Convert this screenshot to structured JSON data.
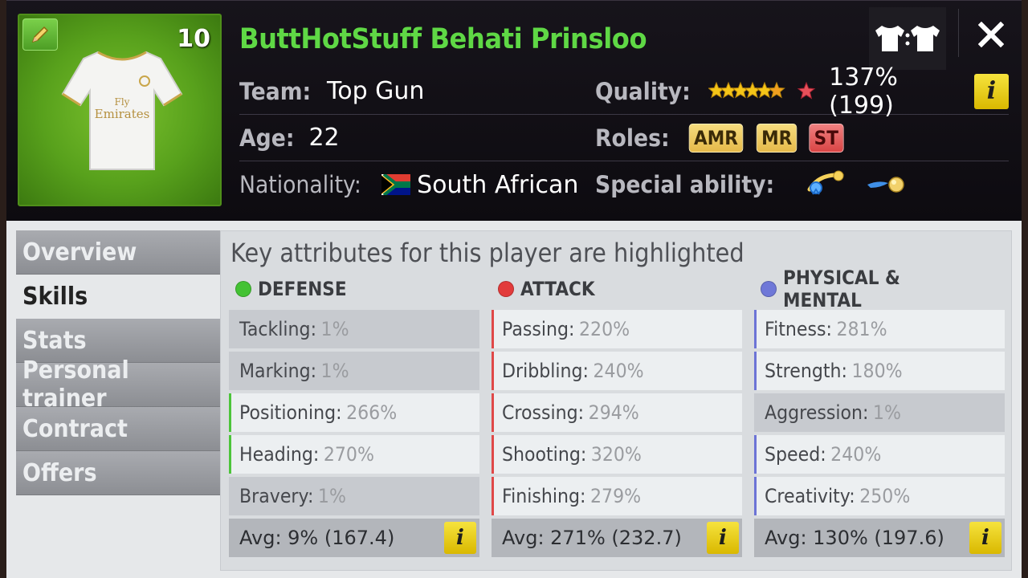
{
  "player": {
    "name": "ButtHotStuff Behati Prinsloo",
    "number": "10",
    "jersey_text": "Fly Emirates"
  },
  "info": {
    "team_label": "Team:",
    "team_value": "Top Gun",
    "age_label": "Age:",
    "age_value": "22",
    "nationality_label": "Nationality:",
    "nationality_value": "South African",
    "quality_label": "Quality:",
    "quality_value": "137% (199)",
    "quality_stars": 6,
    "roles_label": "Roles:",
    "roles": [
      "AMR",
      "MR",
      "ST"
    ],
    "special_label": "Special ability:"
  },
  "tabs": [
    "Overview",
    "Skills",
    "Stats",
    "Personal trainer",
    "Contract",
    "Offers"
  ],
  "active_tab": "Skills",
  "hint": "Key attributes for this player are highlighted",
  "columns": [
    {
      "title": "DEFENSE",
      "color": "#43c233",
      "attrs": [
        {
          "name": "Tackling:",
          "value": "1%"
        },
        {
          "name": "Marking:",
          "value": "1%"
        },
        {
          "name": "Positioning:",
          "value": "266%"
        },
        {
          "name": "Heading:",
          "value": "270%"
        },
        {
          "name": "Bravery:",
          "value": "1%"
        }
      ],
      "avg": "Avg: 9% (167.4)"
    },
    {
      "title": "ATTACK",
      "color": "#e23b3b",
      "attrs": [
        {
          "name": "Passing:",
          "value": "220%"
        },
        {
          "name": "Dribbling:",
          "value": "240%"
        },
        {
          "name": "Crossing:",
          "value": "294%"
        },
        {
          "name": "Shooting:",
          "value": "320%"
        },
        {
          "name": "Finishing:",
          "value": "279%"
        }
      ],
      "avg": "Avg: 271% (232.7)"
    },
    {
      "title": "PHYSICAL & MENTAL",
      "color": "#6f78d8",
      "attrs": [
        {
          "name": "Fitness:",
          "value": "281%"
        },
        {
          "name": "Strength:",
          "value": "180%"
        },
        {
          "name": "Aggression:",
          "value": "1%"
        },
        {
          "name": "Speed:",
          "value": "240%"
        },
        {
          "name": "Creativity:",
          "value": "250%"
        }
      ],
      "avg": "Avg: 130% (197.6)"
    }
  ]
}
